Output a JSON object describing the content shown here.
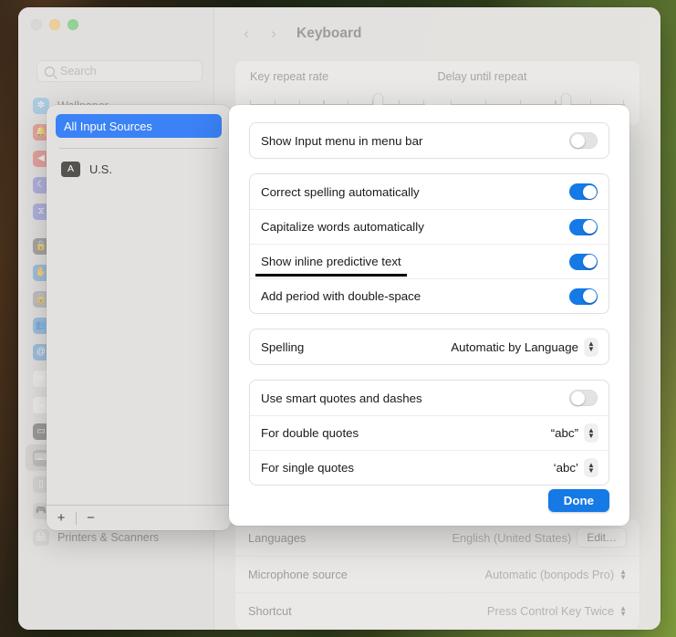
{
  "window": {
    "traffic_lights": [
      "close",
      "minimize",
      "zoom"
    ],
    "search": {
      "placeholder": "Search",
      "icon": "search-icon"
    },
    "page_title": "Keyboard",
    "back_arrow": "‹",
    "forward_arrow": "›"
  },
  "sidebar": {
    "items": [
      {
        "label": "Wallpaper",
        "icon": "wallpaper-icon",
        "color": "#79b6e0",
        "glyph": "✼",
        "selected": false
      },
      {
        "label": "Notifications",
        "icon": "notifications-icon",
        "color": "#e2625c",
        "glyph": "🔔",
        "selected": false
      },
      {
        "label": "Sound",
        "icon": "sound-icon",
        "color": "#e2625c",
        "glyph": "◀",
        "selected": false
      },
      {
        "label": "Focus",
        "icon": "focus-icon",
        "color": "#7b7fd6",
        "glyph": "☾",
        "selected": false
      },
      {
        "label": "Screen Time",
        "icon": "screen-time-icon",
        "color": "#7b7fd6",
        "glyph": "⧖",
        "selected": false
      },
      {
        "label": "Lock Screen",
        "icon": "lock-screen-icon",
        "color": "#6b6763",
        "glyph": "🔒",
        "selected": false
      },
      {
        "label": "Touch ID & Password",
        "icon": "touch-id-icon",
        "color": "#5b9bd5",
        "glyph": "✋",
        "selected": false
      },
      {
        "label": "Privacy & Security",
        "icon": "privacy-icon",
        "color": "#9c9a98",
        "glyph": "🔓",
        "selected": false
      },
      {
        "label": "Users & Groups",
        "icon": "users-groups-icon",
        "color": "#5b9bd5",
        "glyph": "👥",
        "selected": false
      },
      {
        "label": "Internet Accounts",
        "icon": "internet-accounts-icon",
        "color": "#5b9bd5",
        "glyph": "@",
        "selected": false
      },
      {
        "label": "Game Center",
        "icon": "game-center-icon",
        "color": "#f0f0f0",
        "glyph": "◉",
        "selected": false
      },
      {
        "label": "iCloud",
        "icon": "icloud-icon",
        "color": "#f4f4f4",
        "glyph": "☁",
        "selected": false
      },
      {
        "label": "Wallet & Apple Pay",
        "icon": "wallet-icon",
        "color": "#55534f",
        "glyph": "▭",
        "selected": false
      },
      {
        "label": "Keyboard",
        "icon": "keyboard-icon",
        "color": "#9c9a98",
        "glyph": "⌨",
        "selected": true
      },
      {
        "label": "Mouse",
        "icon": "mouse-icon",
        "color": "#c9c7c5",
        "glyph": "▯",
        "selected": false
      },
      {
        "label": "Game Controllers",
        "icon": "game-controllers-icon",
        "color": "#c9c7c5",
        "glyph": "🎮",
        "selected": false
      },
      {
        "label": "Printers & Scanners",
        "icon": "printers-scanners-icon",
        "color": "#c9c7c5",
        "glyph": "🖨",
        "selected": false
      }
    ],
    "separator_after_index": 4
  },
  "detail": {
    "sliders": {
      "key_repeat_rate_label": "Key repeat rate",
      "delay_until_repeat_label": "Delay until repeat",
      "key_repeat_position_pct": 73,
      "delay_position_pct": 66
    },
    "bottom_rows": [
      {
        "label": "Languages",
        "value": "English (United States)",
        "control": "edit-button",
        "button_label": "Edit…"
      },
      {
        "label": "Microphone source",
        "value": "Automatic (bonpods Pro)",
        "control": "stepper"
      },
      {
        "label": "Shortcut",
        "value": "Press Control Key Twice",
        "control": "stepper"
      }
    ]
  },
  "input_panel": {
    "selected_source": "All Input Sources",
    "sources": [
      {
        "badge": "A",
        "name": "U.S."
      }
    ],
    "add_button": "+",
    "remove_button": "−"
  },
  "sheet": {
    "groups": [
      {
        "rows": [
          {
            "label": "Show Input menu in menu bar",
            "control": "toggle",
            "value": "off"
          }
        ]
      },
      {
        "rows": [
          {
            "label": "Correct spelling automatically",
            "control": "toggle",
            "value": "on"
          },
          {
            "label": "Capitalize words automatically",
            "control": "toggle",
            "value": "on"
          },
          {
            "label": "Show inline predictive text",
            "control": "toggle",
            "value": "on",
            "annotated": true
          },
          {
            "label": "Add period with double-space",
            "control": "toggle",
            "value": "on"
          }
        ]
      },
      {
        "rows": [
          {
            "label": "Spelling",
            "control": "stepper",
            "value": "Automatic by Language"
          }
        ]
      },
      {
        "rows": [
          {
            "label": "Use smart quotes and dashes",
            "control": "toggle",
            "value": "off"
          },
          {
            "label": "For double quotes",
            "control": "stepper",
            "value": "“abc”"
          },
          {
            "label": "For single quotes",
            "control": "stepper",
            "value": "‘abc’"
          }
        ]
      }
    ],
    "done_label": "Done"
  },
  "colors": {
    "accent_blue": "#1579e6",
    "selection_blue": "#3b82f6",
    "toggle_off_gray": "#e4e3e2",
    "annotation_black": "#000000"
  }
}
